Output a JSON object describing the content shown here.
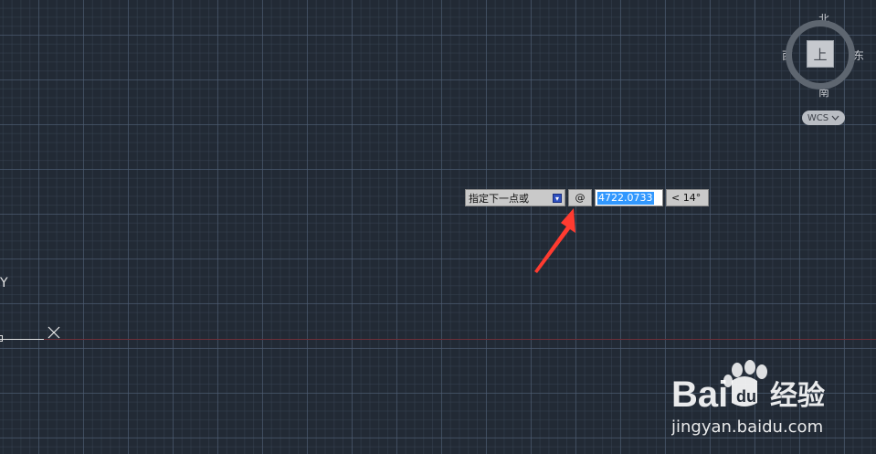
{
  "viewcube": {
    "north": "北",
    "south": "南",
    "west": "西",
    "east": "东",
    "face_label": "上",
    "wcs_label": "WCS",
    "wcs_icon": "chevron-down-icon"
  },
  "ucs_icon": {
    "y_label": "Y"
  },
  "dynamic_input": {
    "prompt": "指定下一点或",
    "prompt_dropdown_icon": "arrow-down-icon",
    "relative_symbol": "@",
    "distance_value": "4722.0733",
    "angle_value": "< 14°"
  },
  "watermark": {
    "brand_left": "Bai",
    "brand_right": "经验",
    "url": "jingyan.baidu.com"
  },
  "colors": {
    "background": "#222a35",
    "grid_major": "#505e76",
    "x_axis_line": "#6e2f38",
    "annotation_arrow": "#ff3b30",
    "selection_highlight": "#3298fe"
  }
}
